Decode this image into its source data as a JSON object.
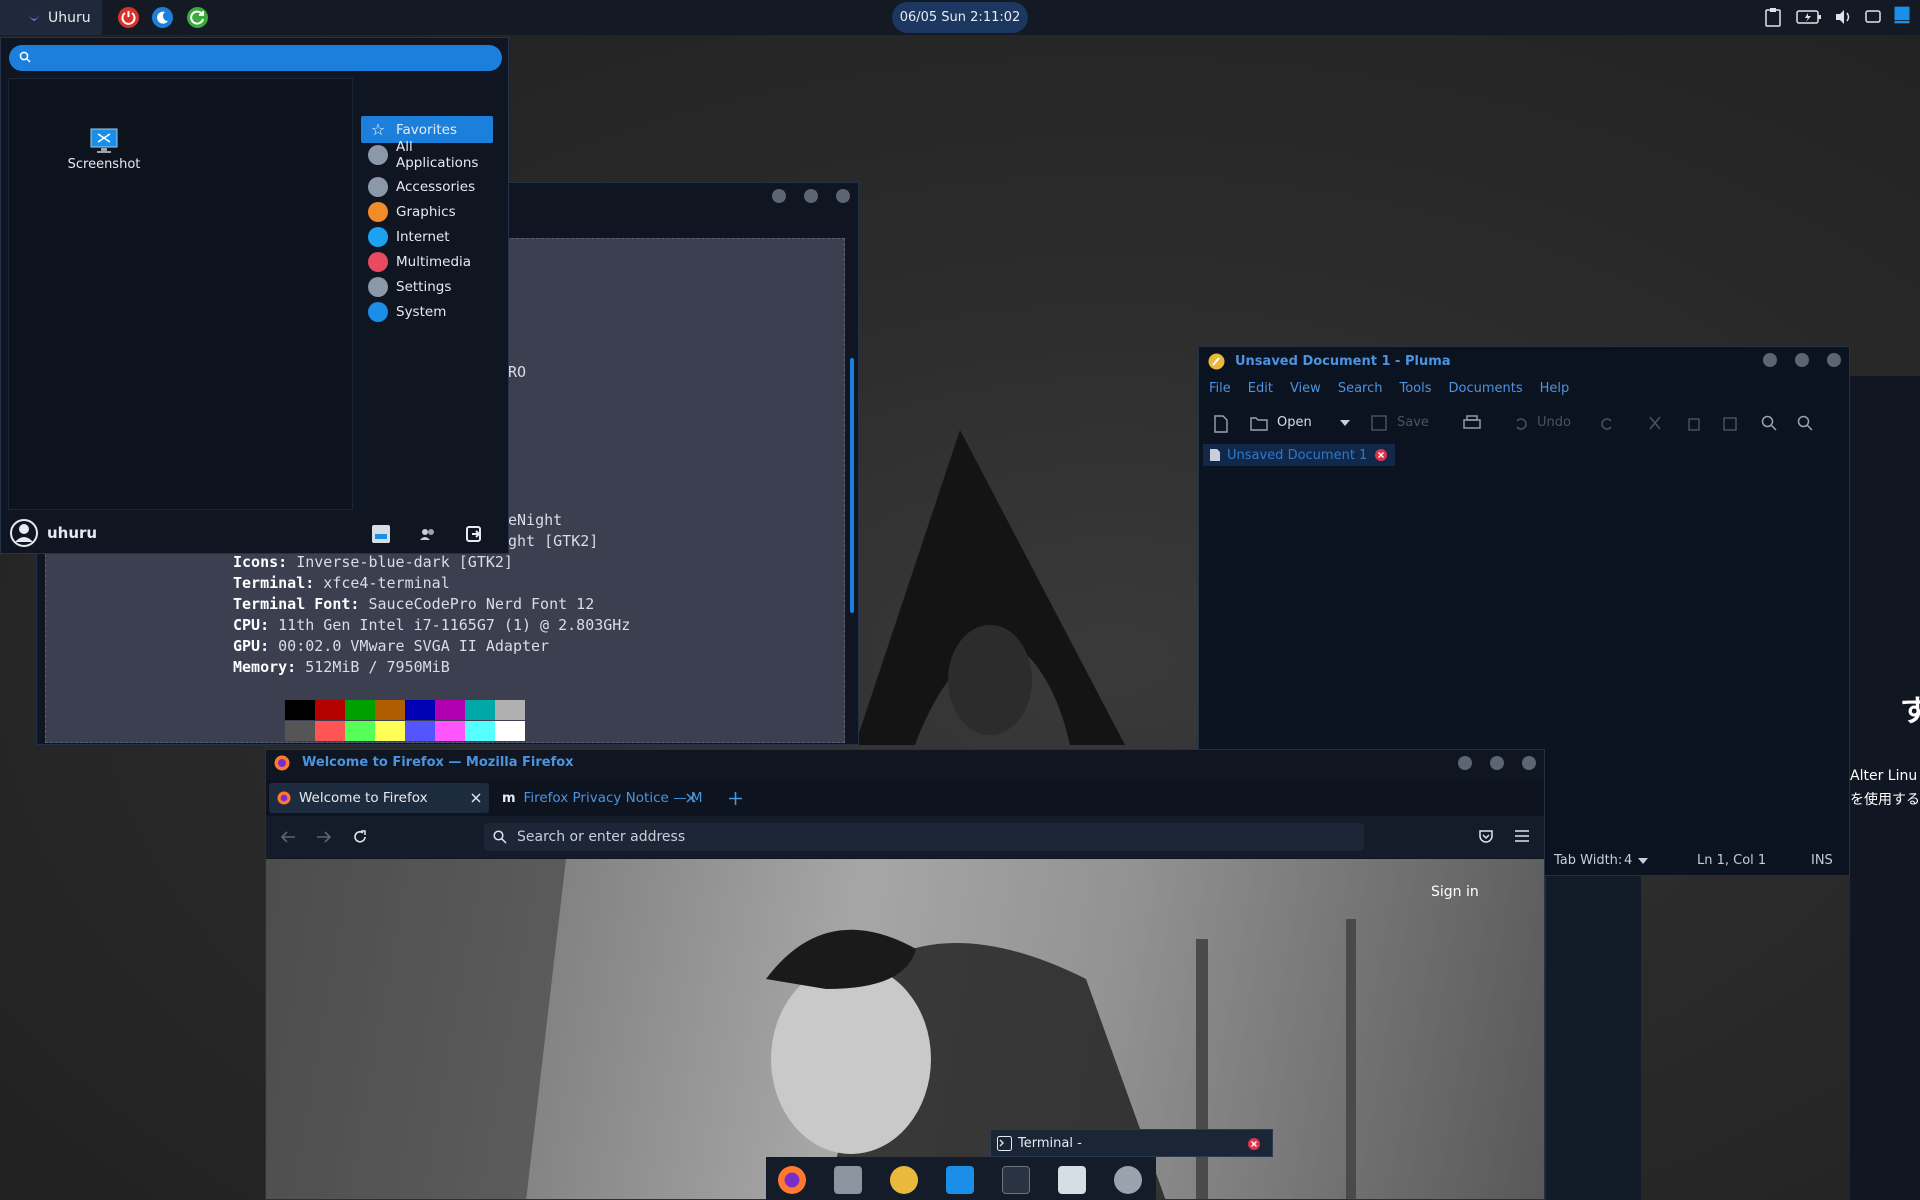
{
  "panel": {
    "menu_label": "Uhuru",
    "clock": "06/05 Sun  2:11:02"
  },
  "app_menu": {
    "search_placeholder": "",
    "apps": [
      {
        "label": "Screenshot",
        "icon": "screenshot-icon"
      }
    ],
    "categories": [
      {
        "label": "Favorites",
        "icon": "star-icon",
        "color": "#1b7fdb",
        "active": true
      },
      {
        "label": "All Applications",
        "icon": "gear-icon",
        "color": "#8a98a8"
      },
      {
        "label": "Accessories",
        "icon": "gear-icon",
        "color": "#8a98a8"
      },
      {
        "label": "Graphics",
        "icon": "palette-icon",
        "color": "#f28c28"
      },
      {
        "label": "Internet",
        "icon": "globe-icon",
        "color": "#1da1f2"
      },
      {
        "label": "Multimedia",
        "icon": "music-icon",
        "color": "#e84a5f"
      },
      {
        "label": "Settings",
        "icon": "settings-icon",
        "color": "#8a98a8"
      },
      {
        "label": "System",
        "icon": "gear-icon",
        "color": "#1b8fe8"
      }
    ],
    "user": "uhuru"
  },
  "terminal": {
    "frag_ro": "RO",
    "frag_night": "eNight",
    "frag_gtk": "ght [GTK2]",
    "lines": [
      {
        "key": "Icons:",
        "value": " Inverse-blue-dark [GTK2]"
      },
      {
        "key": "Terminal:",
        "value": " xfce4-terminal"
      },
      {
        "key": "Terminal Font:",
        "value": " SauceCodePro Nerd Font 12"
      },
      {
        "key": "CPU:",
        "value": " 11th Gen Intel i7-1165G7 (1) @ 2.803GHz"
      },
      {
        "key": "GPU:",
        "value": " 00:02.0 VMware SVGA II Adapter"
      },
      {
        "key": "Memory:",
        "value": " 512MiB / 7950MiB"
      }
    ],
    "palette_top": [
      "#000000",
      "#b50000",
      "#00a000",
      "#b05c00",
      "#0000b4",
      "#b000b0",
      "#00a8a8",
      "#b0b0b0"
    ],
    "palette_bottom": [
      "#555555",
      "#ff5555",
      "#55ff55",
      "#ffff55",
      "#5555ff",
      "#ff55ff",
      "#55ffff",
      "#ffffff"
    ]
  },
  "pluma": {
    "title": "Unsaved Document 1 - Pluma",
    "menu": [
      "File",
      "Edit",
      "View",
      "Search",
      "Tools",
      "Documents",
      "Help"
    ],
    "toolbar": {
      "open": "Open",
      "save": "Save",
      "undo": "Undo"
    },
    "tab": "Unsaved Document 1",
    "status": {
      "tab_width": "Tab Width:",
      "tab_width_value": "4",
      "position": "Ln 1, Col 1",
      "mode": "INS"
    }
  },
  "partial_window": {
    "line1": "す",
    "line2": "Alter Linu",
    "line3": "を使用する"
  },
  "firefox": {
    "title": "Welcome to Firefox — Mozilla Firefox",
    "tabs": [
      {
        "label": "Welcome to Firefox"
      },
      {
        "label": "Firefox Privacy Notice — M"
      }
    ],
    "url_placeholder": "Search or enter address",
    "sign_in": "Sign in"
  },
  "taskbar": {
    "terminal_label": "Terminal -"
  }
}
